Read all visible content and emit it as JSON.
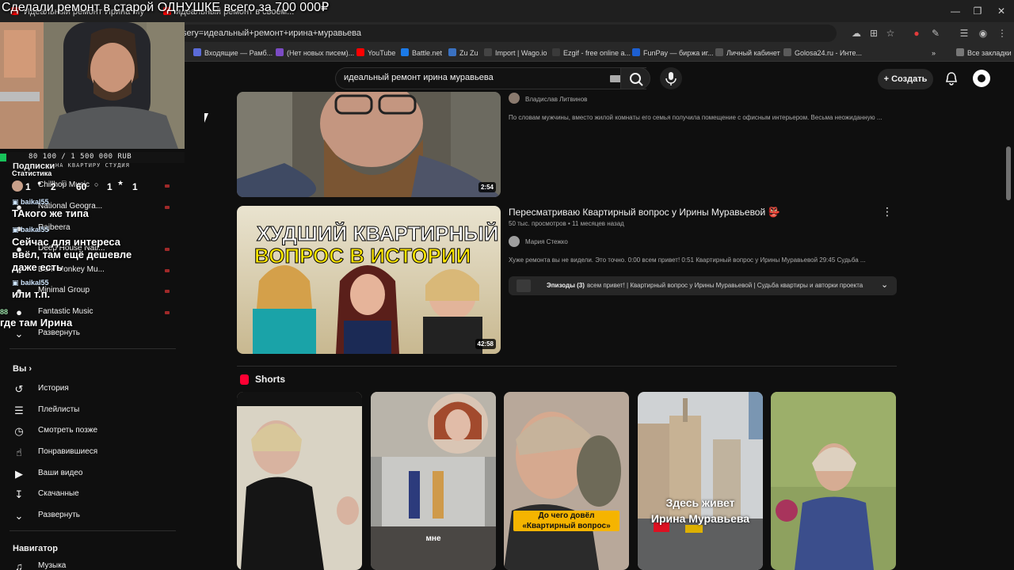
{
  "stream_title": "Сделали ремонт в старой ОДНУШКЕ всего за 700 000₽",
  "browser": {
    "tabs": [
      {
        "label": "Идеальный ремонт Ирина Му"
      },
      {
        "label": "идеальный ремонт в своём..."
      }
    ],
    "url": "sery=идеальный+ремонт+ирина+муравьева",
    "bookmarks": [
      {
        "label": "Входящие — Рамб...",
        "color": "#5b6bd8"
      },
      {
        "label": "(Нет новых писем)...",
        "color": "#7b4bc4"
      },
      {
        "label": "YouTube",
        "color": "#ff0000"
      },
      {
        "label": "Battle.net",
        "color": "#1b7ae8"
      },
      {
        "label": "Zu Zu",
        "color": "#3a71c1"
      },
      {
        "label": "Import | Wago.io",
        "color": "#444444"
      },
      {
        "label": "Ezgif - free online a...",
        "color": "#3a3a3a"
      },
      {
        "label": "FunPay — биржа иг...",
        "color": "#1d5fd1"
      },
      {
        "label": "Личный кабинет",
        "color": "#555555"
      },
      {
        "label": "Golosa24.ru - Инте...",
        "color": "#5a5a5a"
      }
    ],
    "all_bookmarks": "Все закладки"
  },
  "header": {
    "search_value": "идеальный ремонт ирина муравьева",
    "create_label": "Создать"
  },
  "overlay": {
    "progress": "80 100 / 1 500 000 RUB",
    "goal": "НА КВАРТИРУ СТУДИЯ",
    "subs_label": "Подписки",
    "stats_label": "Статистика",
    "stats": [
      "1",
      "2",
      "60",
      "1",
      "1"
    ],
    "user": "baikal55",
    "messages": [
      "ТАкого же типа",
      "Сейчас для интереса",
      "ввёл, там ещё дешевле",
      "даже есть",
      "или т.п.",
      "где там Ирина"
    ],
    "count_88": "88"
  },
  "sidebar": {
    "subscriptions": [
      {
        "label": "Chillhop Music"
      },
      {
        "label": "National Geogra..."
      },
      {
        "label": "Rajbeera"
      },
      {
        "label": "Deep House Nati..."
      },
      {
        "label": "Dark Monkey Mu..."
      },
      {
        "label": "Minimal Group"
      },
      {
        "label": "Fantastic Music"
      }
    ],
    "expand1": "Развернуть",
    "you_label": "Вы",
    "you_items": [
      {
        "label": "История",
        "icon": "history-icon"
      },
      {
        "label": "Плейлисты",
        "icon": "playlist-icon"
      },
      {
        "label": "Смотреть позже",
        "icon": "clock-icon"
      },
      {
        "label": "Понравившиеся",
        "icon": "like-icon"
      },
      {
        "label": "Ваши видео",
        "icon": "video-icon"
      },
      {
        "label": "Скачанные",
        "icon": "download-icon"
      }
    ],
    "expand2": "Развернуть",
    "nav_label": "Навигатор",
    "nav_first": "Музыка"
  },
  "videos": [
    {
      "channel": "Владислав Литвинов",
      "description": "По словам мужчины, вместо жилой комнаты его семья получила помещение с офисным интерьером. Весьма неожиданную ...",
      "duration": "2:54"
    },
    {
      "title": "Пересматриваю Квартирный вопрос у Ирины Муравьевой 👺",
      "meta": "50 тыс. просмотров • 11 месяцев назад",
      "channel": "Мария Стежко",
      "description": "Хуже ремонта вы не видели. Это точно. 0:00 всем привет! 0:51 Квартирный вопрос у Ирины Муравьевой 29:45 Судьба ...",
      "thumb_line1": "ХУДШИЙ КВАРТИРНЫЙ",
      "thumb_line2": "ВОПРОС В ИСТОРИИ",
      "duration": "42:58",
      "episodes_label": "Эпизоды (3)",
      "episodes_text": "всем привет! | Квартирный вопрос у Ирины Муравьевой | Судьба квартиры и авторки проекта"
    }
  ],
  "shorts": {
    "heading": "Shorts",
    "captions": [
      "",
      "мне",
      "До чего довёл «Квартирный вопрос»",
      "Здесь живет Ирина Муравьева",
      ""
    ]
  }
}
